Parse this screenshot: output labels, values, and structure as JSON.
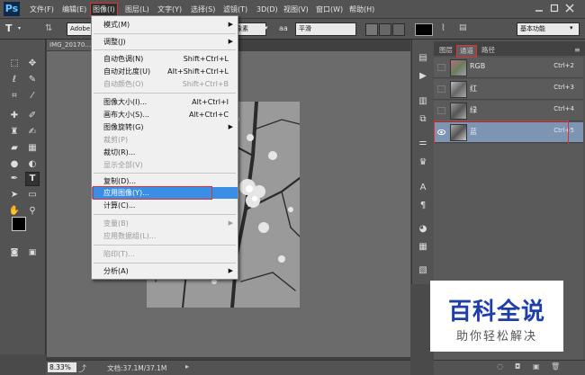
{
  "app": {
    "logo": "Ps"
  },
  "menubar": {
    "items": [
      "文件(F)",
      "编辑(E)",
      "图像(I)",
      "图层(L)",
      "文字(Y)",
      "选择(S)",
      "滤镜(T)",
      "3D(D)",
      "视图(V)",
      "窗口(W)",
      "帮助(H)"
    ]
  },
  "options_bar": {
    "tool_icon": "T",
    "font_family": "Adobe ...",
    "font_size_unit": "像素",
    "aa_icon": "aa",
    "antialias": "平滑",
    "workspace": "基本功能"
  },
  "document": {
    "tab_title": "IMG_20170…",
    "zoom": "8.33%",
    "doc_info": "文档:37.1M/37.1M"
  },
  "image_menu": {
    "items": [
      {
        "label": "模式(M)",
        "shortcut": "",
        "submenu": true,
        "disabled": false
      },
      {
        "label": "调整(J)",
        "shortcut": "",
        "submenu": true,
        "disabled": false
      },
      {
        "label": "自动色调(N)",
        "shortcut": "Shift+Ctrl+L",
        "submenu": false,
        "disabled": false
      },
      {
        "label": "自动对比度(U)",
        "shortcut": "Alt+Shift+Ctrl+L",
        "submenu": false,
        "disabled": false
      },
      {
        "label": "自动颜色(O)",
        "shortcut": "Shift+Ctrl+B",
        "submenu": false,
        "disabled": true
      },
      {
        "label": "图像大小(I)...",
        "shortcut": "Alt+Ctrl+I",
        "submenu": false,
        "disabled": false
      },
      {
        "label": "画布大小(S)...",
        "shortcut": "Alt+Ctrl+C",
        "submenu": false,
        "disabled": false
      },
      {
        "label": "图像旋转(G)",
        "shortcut": "",
        "submenu": true,
        "disabled": false
      },
      {
        "label": "裁剪(P)",
        "shortcut": "",
        "submenu": false,
        "disabled": true
      },
      {
        "label": "裁切(R)...",
        "shortcut": "",
        "submenu": false,
        "disabled": false
      },
      {
        "label": "显示全部(V)",
        "shortcut": "",
        "submenu": false,
        "disabled": true
      },
      {
        "label": "复制(D)...",
        "shortcut": "",
        "submenu": false,
        "disabled": false
      },
      {
        "label": "应用图像(Y)...",
        "shortcut": "",
        "submenu": false,
        "disabled": false
      },
      {
        "label": "计算(C)...",
        "shortcut": "",
        "submenu": false,
        "disabled": false
      },
      {
        "label": "变量(B)",
        "shortcut": "",
        "submenu": true,
        "disabled": true
      },
      {
        "label": "应用数据组(L)...",
        "shortcut": "",
        "submenu": false,
        "disabled": true
      },
      {
        "label": "陷印(T)...",
        "shortcut": "",
        "submenu": false,
        "disabled": true
      },
      {
        "label": "分析(A)",
        "shortcut": "",
        "submenu": true,
        "disabled": false
      }
    ]
  },
  "panel": {
    "tabs": [
      "图层",
      "通道",
      "路径"
    ],
    "channels": [
      {
        "name": "RGB",
        "shortcut": "Ctrl+2"
      },
      {
        "name": "红",
        "shortcut": "Ctrl+3"
      },
      {
        "name": "绿",
        "shortcut": "Ctrl+4"
      },
      {
        "name": "蓝",
        "shortcut": "Ctrl+5"
      }
    ]
  },
  "watermark": {
    "title": "百科全说",
    "subtitle": "助你轻松解决"
  },
  "colors": {
    "highlight_red": "#e03030",
    "menu_select": "#3a8ee6",
    "watermark_blue": "#1f3fa8"
  }
}
